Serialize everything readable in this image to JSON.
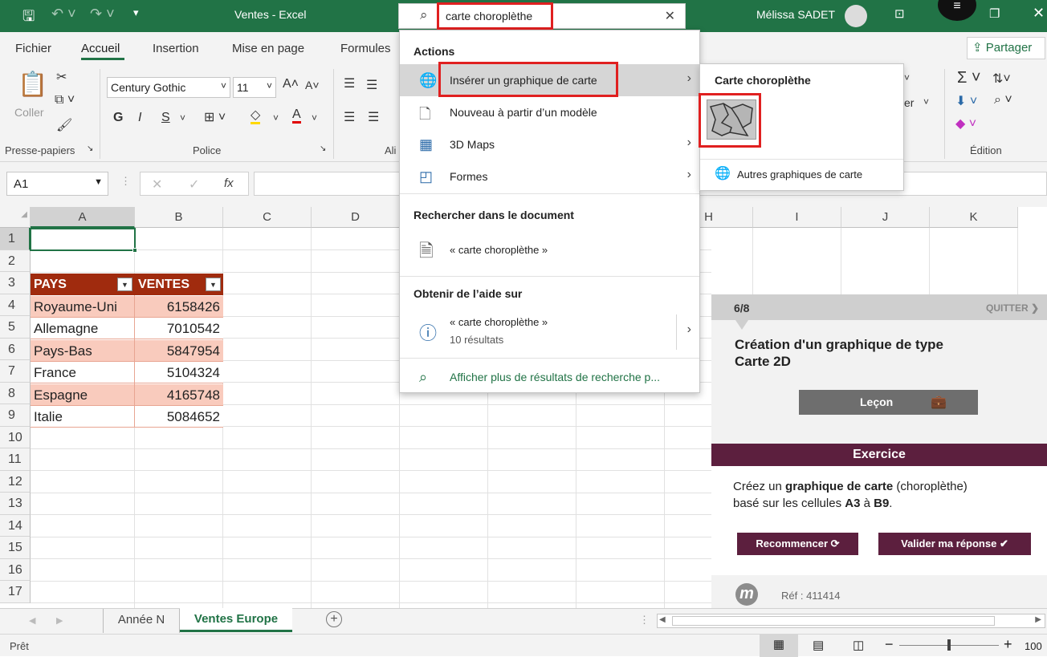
{
  "titlebar": {
    "doc_title": "Ventes - Excel",
    "user": "Mélissa SADET",
    "search_value": "carte choroplèthe"
  },
  "tabs": [
    "Fichier",
    "Accueil",
    "Insertion",
    "Mise en page",
    "Formules"
  ],
  "share_label": "Partager",
  "ribbon": {
    "paste_label": "Coller",
    "clipboard_group": "Presse-papiers",
    "font_name": "Century Gothic",
    "font_size": "11",
    "font_group": "Police",
    "align_group": "Ali",
    "edit_group": "Édition",
    "bold": "G",
    "italic": "I",
    "underline": "S",
    "number_fragment": "er"
  },
  "formula": {
    "name_box": "A1",
    "fx": "fx"
  },
  "columns": [
    "A",
    "B",
    "C",
    "D",
    "E",
    "F",
    "G",
    "H",
    "I",
    "J",
    "K"
  ],
  "rows": [
    "1",
    "2",
    "3",
    "4",
    "5",
    "6",
    "7",
    "8",
    "9",
    "10",
    "11",
    "12",
    "13",
    "14",
    "15",
    "16",
    "17"
  ],
  "table": {
    "headers": [
      "PAYS",
      "VENTES"
    ],
    "rows": [
      {
        "pays": "Royaume-Uni",
        "ventes": "6158426"
      },
      {
        "pays": "Allemagne",
        "ventes": "7010542"
      },
      {
        "pays": "Pays-Bas",
        "ventes": "5847954"
      },
      {
        "pays": "France",
        "ventes": "5104324"
      },
      {
        "pays": "Espagne",
        "ventes": "4165748"
      },
      {
        "pays": "Italie",
        "ventes": "5084652"
      }
    ],
    "colors": {
      "header": "#a02b0e",
      "band": "#f9cbbd"
    }
  },
  "dropdown": {
    "actions_heading": "Actions",
    "items": [
      "Insérer un graphique de carte",
      "Nouveau à partir d’un modèle",
      "3D Maps",
      "Formes"
    ],
    "search_heading": "Rechercher dans le document",
    "search_item": "« carte choroplèthe »",
    "help_heading": "Obtenir de l’aide sur",
    "help_item": "« carte choroplèthe »",
    "help_count": "10 résultats",
    "more": "Afficher plus de résultats de recherche p..."
  },
  "submenu": {
    "title": "Carte choroplèthe",
    "other": "Autres graphiques de carte"
  },
  "tutor": {
    "step": "6/8",
    "quit": "QUITTER",
    "title_line1": "Création d'un graphique de type",
    "title_line2": "Carte 2D",
    "lesson": "Leçon",
    "exercise": "Exercice",
    "instr_1": "Créez un ",
    "instr_bold": "graphique de carte",
    "instr_2": " (choroplèthe)",
    "instr_3": "basé sur les cellules ",
    "instr_a3": "A3",
    "instr_4": " à ",
    "instr_b9": "B9",
    "instr_5": ".",
    "restart": "Recommencer",
    "validate": "Valider ma réponse",
    "ref": "Réf : 411414",
    "logo": "m",
    "colors": {
      "accent": "#5c1f3e"
    }
  },
  "sheets": [
    "Année N",
    "Ventes Europe"
  ],
  "status": {
    "ready": "Prêt",
    "zoom": "100"
  }
}
